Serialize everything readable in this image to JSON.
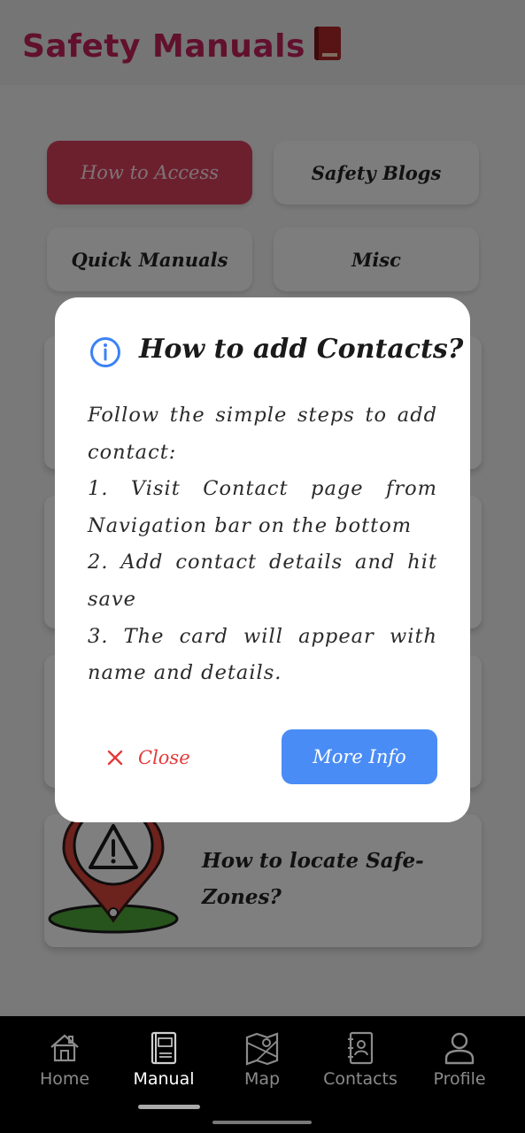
{
  "header": {
    "title": "Safety Manuals",
    "icon": "red-book-icon"
  },
  "tabs": [
    {
      "label": "How to Access",
      "active": true
    },
    {
      "label": "Safety Blogs",
      "active": false
    },
    {
      "label": "Quick Manuals",
      "active": false
    },
    {
      "label": "Misc",
      "active": false
    }
  ],
  "cards": [
    {
      "title": "How to locate Safe-Zones?",
      "icon": "location-warning-icon"
    }
  ],
  "dialog": {
    "icon": "info-icon",
    "title": "How to add Contacts?",
    "body": [
      "Follow the simple steps to add contact:",
      "1. Visit Contact page from Navigation bar on the bottom",
      "2. Add contact details and hit save",
      "3. The card will appear with name and details."
    ],
    "close_label": "Close",
    "more_label": "More Info"
  },
  "bottom_nav": [
    {
      "label": "Home",
      "icon": "home-icon",
      "active": false
    },
    {
      "label": "Manual",
      "icon": "user-guide-icon",
      "active": true
    },
    {
      "label": "Map",
      "icon": "map-icon",
      "active": false
    },
    {
      "label": "Contacts",
      "icon": "contacts-icon",
      "active": false
    },
    {
      "label": "Profile",
      "icon": "profile-icon",
      "active": false
    }
  ],
  "colors": {
    "brand": "#c2235a",
    "active_tab": "#d8405c",
    "primary_button": "#4a8cf5",
    "close": "#e23a3a"
  }
}
